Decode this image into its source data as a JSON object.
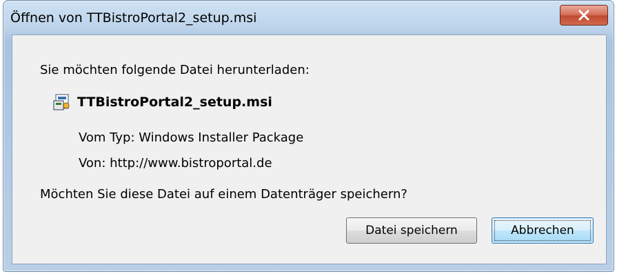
{
  "window": {
    "title": "Öffnen von TTBistroPortal2_setup.msi",
    "close_icon": "close-icon"
  },
  "dialog": {
    "prompt": "Sie möchten folgende Datei herunterladen:",
    "file": {
      "icon": "msi-installer-icon",
      "name": "TTBistroPortal2_setup.msi",
      "type_line": "Vom Typ:  Windows Installer Package",
      "source_line": "Von:  http://www.bistroportal.de"
    },
    "question": "Möchten Sie diese Datei auf einem Datenträger speichern?",
    "buttons": {
      "save": "Datei speichern",
      "cancel": "Abbrechen"
    }
  },
  "colors": {
    "title_gradient_top": "#cfe2f4",
    "content_bg": "#f0f0f0",
    "close_button": "#c14a2f",
    "default_button": "#bee6fd"
  }
}
